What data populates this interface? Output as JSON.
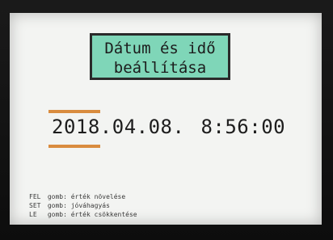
{
  "title": {
    "line1": "Dátum és idő",
    "line2": "beállítása"
  },
  "datetime": {
    "year": "2018",
    "rest_of_date": ".04.08.",
    "time": "8:56:00",
    "selected_field": "year"
  },
  "help": [
    {
      "key": "FEL",
      "text": "gomb: érték növelése"
    },
    {
      "key": "SET",
      "text": "gomb: jóváhagyás"
    },
    {
      "key": "LE",
      "text": "gomb: érték csökkentése"
    }
  ],
  "colors": {
    "title_bg": "#7fd6b8",
    "cursor": "#d98c3f",
    "screen_bg": "#f3f4f2"
  }
}
